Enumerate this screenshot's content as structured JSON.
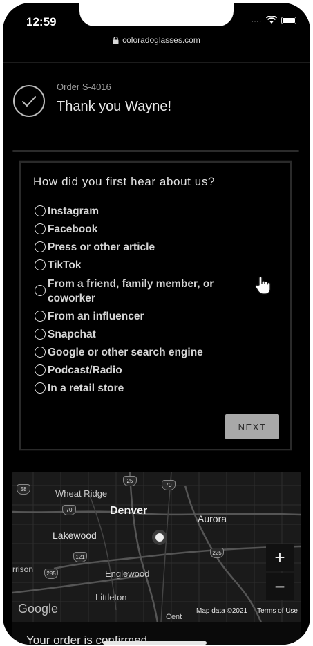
{
  "status_bar": {
    "time": "12:59"
  },
  "browser": {
    "url": "coloradoglasses.com"
  },
  "order": {
    "number": "Order S-4016",
    "thanks": "Thank you Wayne!"
  },
  "survey": {
    "question": "How did you first hear about us?",
    "options": [
      "Instagram",
      "Facebook",
      "Press or other article",
      "TikTok",
      "From a friend, family member, or coworker",
      "From an influencer",
      "Snapchat",
      "Google or other search engine",
      "Podcast/Radio",
      "In a retail store"
    ],
    "next_label": "NEXT"
  },
  "map": {
    "cities": {
      "wheat_ridge": "Wheat Ridge",
      "denver": "Denver",
      "aurora": "Aurora",
      "lakewood": "Lakewood",
      "englewood": "Englewood",
      "littleton": "Littleton",
      "morrison": "rrison",
      "cent": "Cent"
    },
    "shields": {
      "s58": "58",
      "s25a": "25",
      "s70a": "70",
      "s70b": "70",
      "s121": "121",
      "s225": "225",
      "s285": "285"
    },
    "zoom_in": "+",
    "zoom_out": "−",
    "logo": "Google",
    "data_credit": "Map data ©2021",
    "terms": "Terms of Use"
  },
  "footer": {
    "confirmed": "Your order is confirmed"
  },
  "colors": {
    "background": "#000000",
    "button": "#a8a8a8",
    "text": "#e2e2e2"
  }
}
